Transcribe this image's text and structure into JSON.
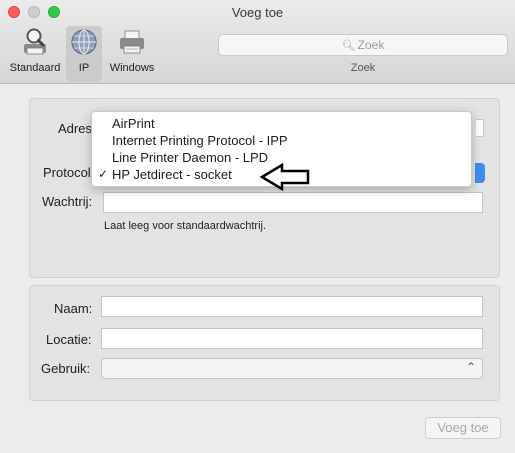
{
  "window": {
    "title": "Voeg toe",
    "buttons": [
      "close",
      "minimize",
      "zoom"
    ]
  },
  "toolbar": {
    "items": [
      {
        "label": "Standaard",
        "icon": "magnifier-printer-icon",
        "selected": false
      },
      {
        "label": "IP",
        "icon": "globe-icon",
        "selected": true
      },
      {
        "label": "Windows",
        "icon": "printer-icon",
        "selected": false
      }
    ],
    "search": {
      "placeholder": "Zoek",
      "label": "Zoek"
    }
  },
  "form": {
    "adres_label": "Adres",
    "protocol_label": "Protocol",
    "wachtrij_label": "Wachtrij:",
    "wachtrij_value": "",
    "wachtrij_hint": "Laat leeg voor standaardwachtrij.",
    "naam_label": "Naam:",
    "naam_value": "",
    "locatie_label": "Locatie:",
    "locatie_value": "",
    "gebruik_label": "Gebruik:",
    "gebruik_value": ""
  },
  "protocol_menu": {
    "options": [
      {
        "label": "AirPrint",
        "checked": false
      },
      {
        "label": "Internet Printing Protocol - IPP",
        "checked": false
      },
      {
        "label": "Line Printer Daemon - LPD",
        "checked": false
      },
      {
        "label": "HP Jetdirect - socket",
        "checked": true
      }
    ],
    "check_glyph": "✓",
    "accent": "#3c8ef5"
  },
  "actions": {
    "add_label": "Voeg toe",
    "add_enabled": false
  }
}
